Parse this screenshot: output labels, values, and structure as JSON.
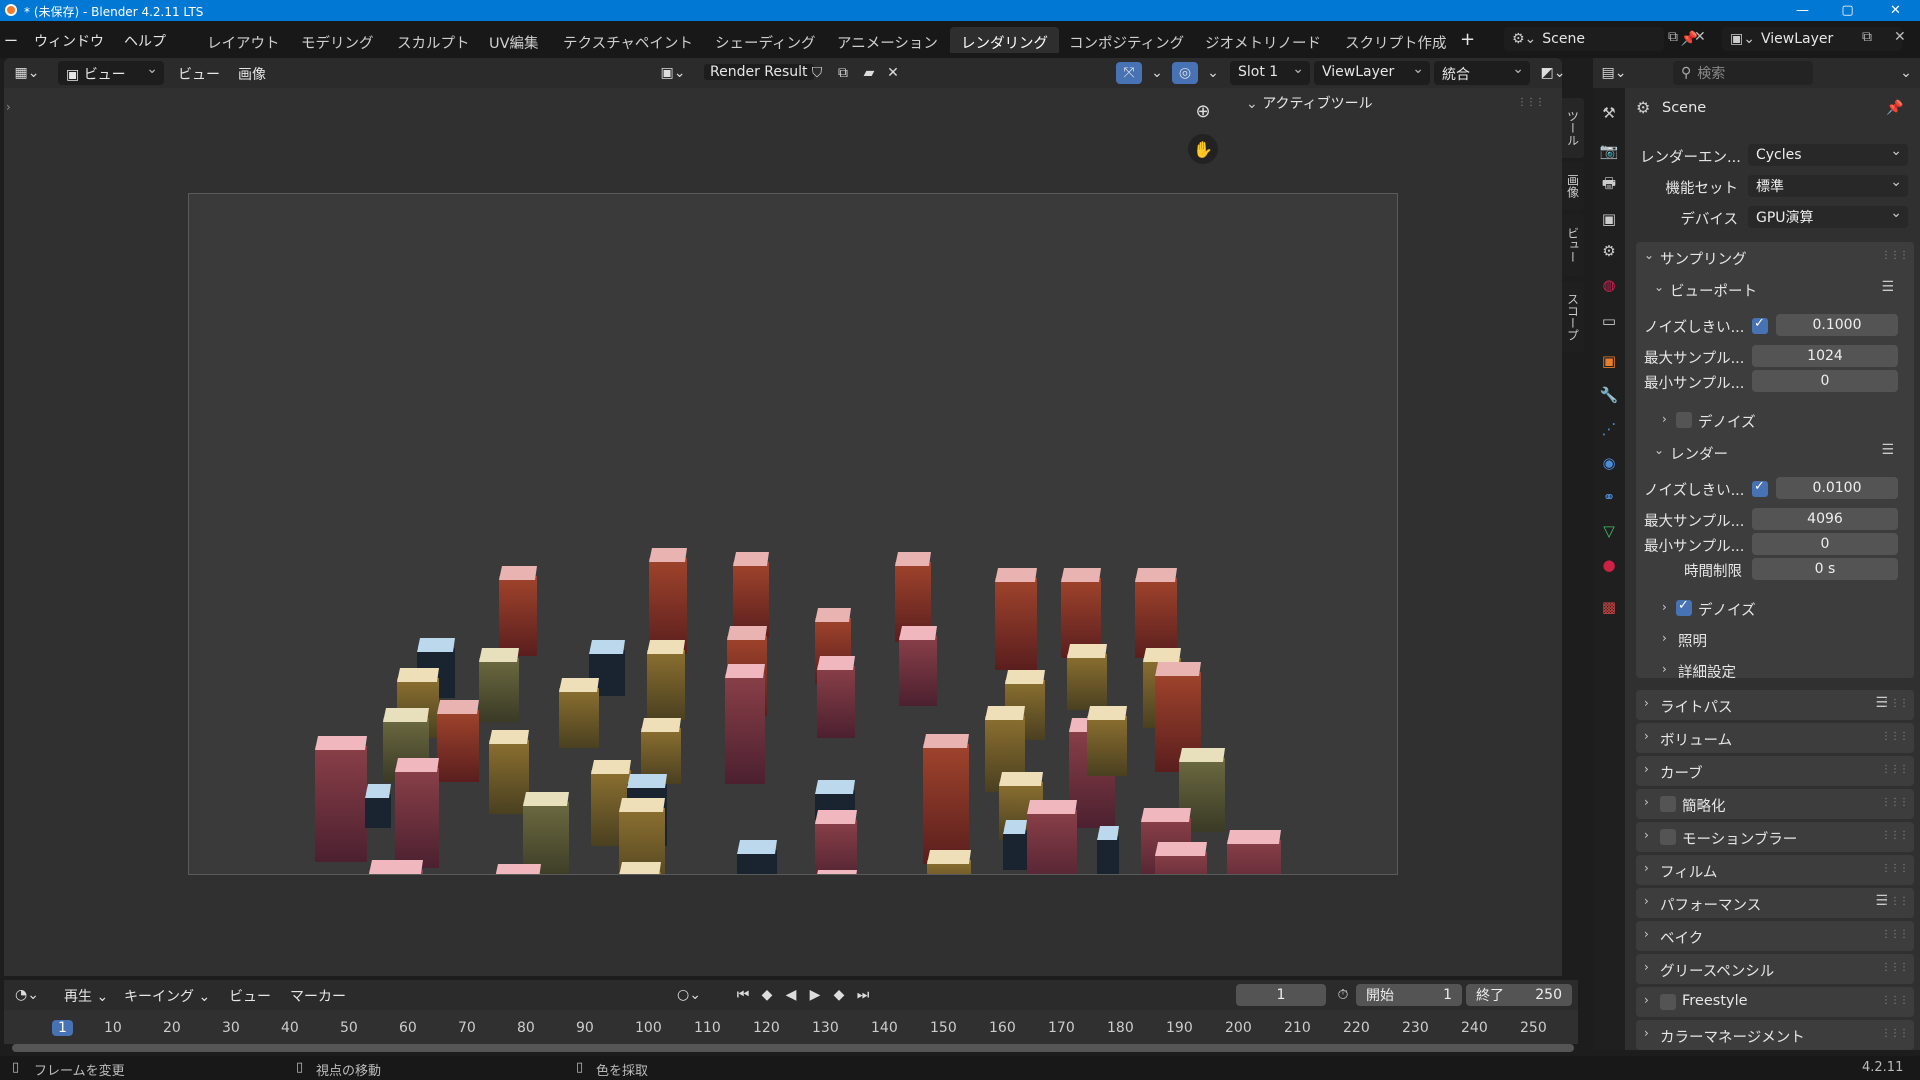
{
  "window": {
    "title": "* (未保存) - Blender 4.2.11 LTS",
    "minimize": "—",
    "maximize": "▢",
    "close": "✕"
  },
  "menus": [
    "ー",
    "ウィンドウ",
    "ヘルプ"
  ],
  "workspaces": [
    "レイアウト",
    "モデリング",
    "スカルプト",
    "UV編集",
    "テクスチャペイント",
    "シェーディング",
    "アニメーション",
    "レンダリング",
    "コンポジティング",
    "ジオメトリノード",
    "スクリプト作成"
  ],
  "active_workspace": "レンダリング",
  "add_workspace": "+",
  "scene": "Scene",
  "view_layer": "ViewLayer",
  "image_editor": {
    "view": "ビュー",
    "view2": "ビュー",
    "image": "画像",
    "render_result": "Render Result",
    "slot": "Slot 1",
    "layer": "ViewLayer",
    "pass": "統合",
    "active_tool": "アクティブツール"
  },
  "sidebar_tabs": [
    "ツール",
    "画像",
    "ビュー",
    "スコープ"
  ],
  "props": {
    "search_placeholder": "検索",
    "scene_name": "Scene",
    "render_engine_label": "レンダーエン...",
    "render_engine": "Cycles",
    "feature_set_label": "機能セット",
    "feature_set": "標準",
    "device_label": "デバイス",
    "device": "GPU演算",
    "sampling": "サンプリング",
    "viewport": "ビューポート",
    "vp_noise_label": "ノイズしきい...",
    "vp_noise": "0.1000",
    "vp_max_label": "最大サンプル...",
    "vp_max": "1024",
    "vp_min_label": "最小サンプル...",
    "vp_min": "0",
    "vp_denoise": "デノイズ",
    "render": "レンダー",
    "r_noise_label": "ノイズしきい...",
    "r_noise": "0.0100",
    "r_max_label": "最大サンプル...",
    "r_max": "4096",
    "r_min_label": "最小サンプル...",
    "r_min": "0",
    "time_limit_label": "時間制限",
    "time_limit": "0 s",
    "r_denoise": "デノイズ",
    "lighting": "照明",
    "advanced": "詳細設定",
    "panels": [
      "ライトパス",
      "ボリューム",
      "カーブ",
      "簡略化",
      "モーションブラー",
      "フィルム",
      "パフォーマンス",
      "ベイク",
      "グリースペンシル",
      "Freestyle",
      "カラーマネージメント"
    ]
  },
  "timeline": {
    "play": "再生",
    "keying": "キーイング",
    "view": "ビュー",
    "marker": "マーカー",
    "current_frame": "1",
    "start_label": "開始",
    "start": "1",
    "end_label": "終了",
    "end": "250",
    "ticks": [
      "1",
      "10",
      "20",
      "30",
      "40",
      "50",
      "60",
      "70",
      "80",
      "90",
      "100",
      "110",
      "120",
      "130",
      "140",
      "150",
      "160",
      "170",
      "180",
      "190",
      "200",
      "210",
      "220",
      "230",
      "240",
      "250"
    ]
  },
  "status": {
    "change_frame": "フレームを変更",
    "move_view": "視点の移動",
    "sample_color": "色を採取",
    "version": "4.2.11"
  }
}
